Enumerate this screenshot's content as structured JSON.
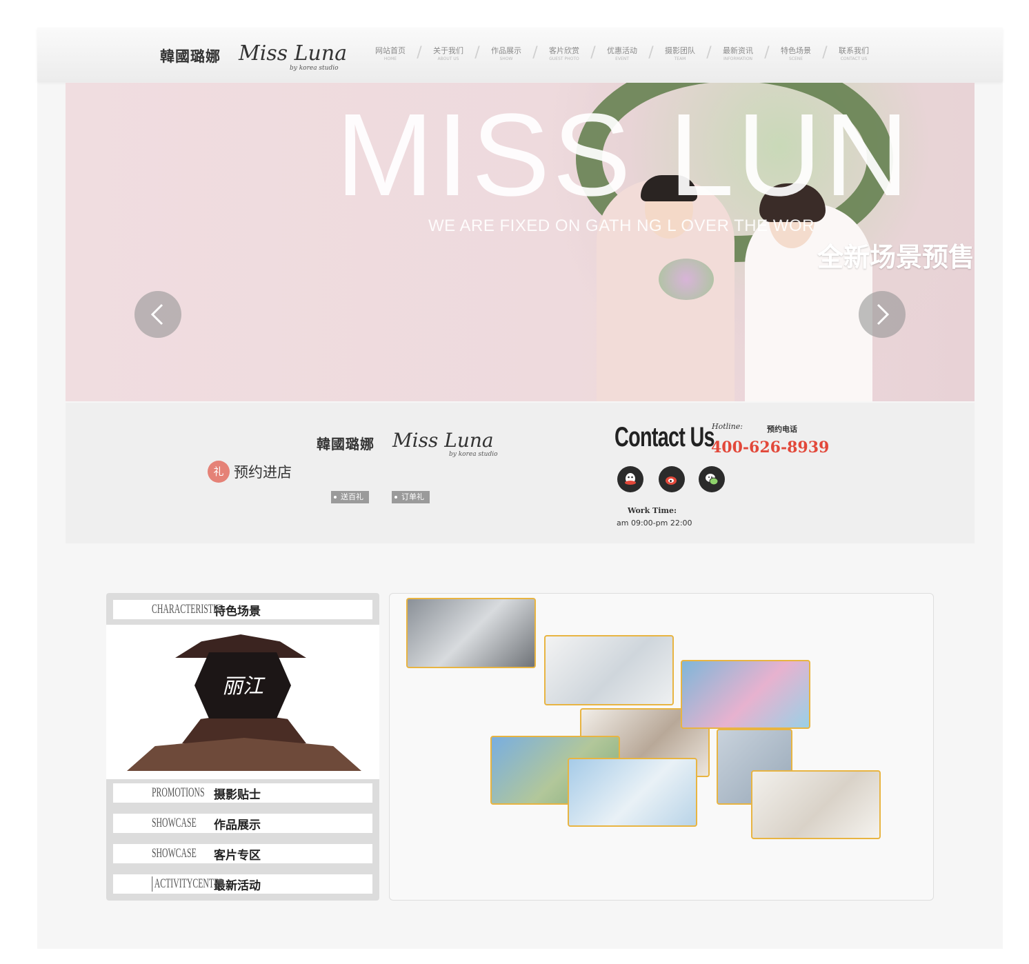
{
  "header": {
    "logo_cn": "韓國璐娜",
    "logo_en": "Miss Luna",
    "logo_sub": "by korea studio",
    "nav": [
      {
        "cn": "网站首页",
        "en": "HOME"
      },
      {
        "cn": "关于我们",
        "en": "ABOUT US"
      },
      {
        "cn": "作品展示",
        "en": "SHOW"
      },
      {
        "cn": "客片欣赏",
        "en": "GUEST PHOTO"
      },
      {
        "cn": "优惠活动",
        "en": "EVENT"
      },
      {
        "cn": "摄影团队",
        "en": "TEAM"
      },
      {
        "cn": "最新资讯",
        "en": "INFORMATION"
      },
      {
        "cn": "特色场景",
        "en": "SCENE"
      },
      {
        "cn": "联系我们",
        "en": "CONTACT US"
      }
    ],
    "nav_separator": "/"
  },
  "banner": {
    "title": "MISS LUN",
    "tagline": "WE ARE FIXED ON GATH      NG        L OVER THE WOR",
    "cn_text": "全新场景预售",
    "prev_icon": "chevron-left-icon",
    "next_icon": "chevron-right-icon"
  },
  "info": {
    "logo_cn": "韓國璐娜",
    "logo_en": "Miss Luna",
    "logo_sub": "by korea studio",
    "book_icon_text": "礼",
    "book_text": "预约进店",
    "tags": [
      "送百礼",
      "订单礼"
    ],
    "contact_title": "Contact Us",
    "hotline_label": "Hotline:",
    "hotline_cn": "预约电话",
    "phone": "400-626-8939",
    "social": [
      "qq-icon",
      "weibo-icon",
      "wechat-icon"
    ],
    "worktime_label": "Work Time:",
    "worktime": "am 09:00-pm 22:00"
  },
  "sidebar": {
    "sections": [
      {
        "en": "CHARACTERISTIC",
        "cn": "特色场景"
      },
      {
        "en": "PROMOTIONS",
        "cn": "摄影贴士"
      },
      {
        "en": "SHOWCASE",
        "cn": "作品展示"
      },
      {
        "en": "SHOWCASE",
        "cn": "客片专区"
      },
      {
        "en": "ACTIVITYCENTER",
        "cn": "最新活动"
      }
    ],
    "feature_sign": "丽江"
  },
  "colors": {
    "accent_red": "#e2483a",
    "photo_border": "#e8b441",
    "banner_pink": "#eedadd"
  }
}
